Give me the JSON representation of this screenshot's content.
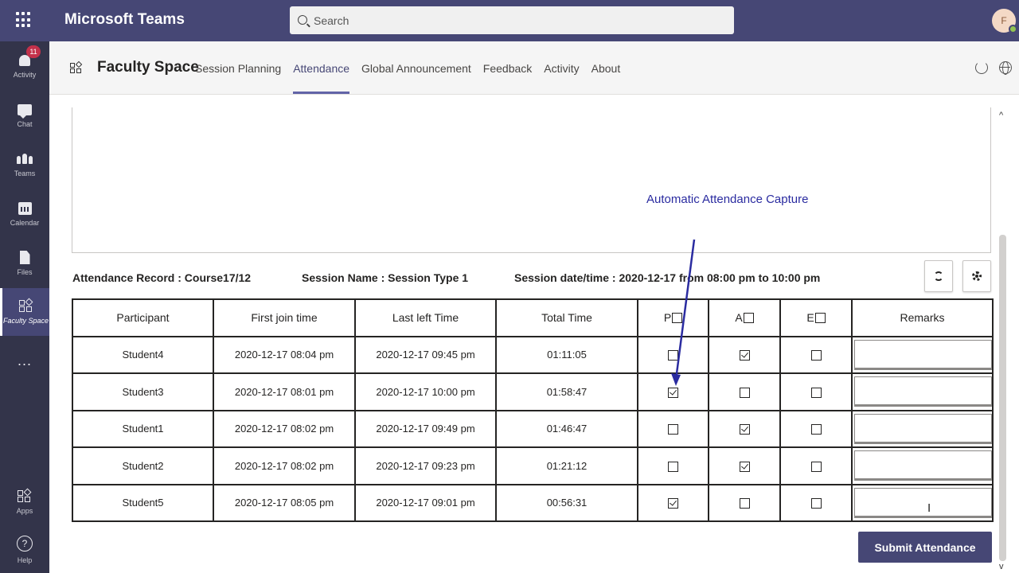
{
  "topbar": {
    "app_title": "Microsoft Teams",
    "search_placeholder": "Search",
    "avatar_initial": "F"
  },
  "rail": {
    "items": [
      {
        "label": "Activity",
        "badge": "11"
      },
      {
        "label": "Chat"
      },
      {
        "label": "Teams"
      },
      {
        "label": "Calendar"
      },
      {
        "label": "Files"
      },
      {
        "label": "Faculty Space"
      },
      {
        "label": "..."
      }
    ],
    "bottom": [
      {
        "label": "Apps"
      },
      {
        "label": "Help"
      }
    ]
  },
  "app_header": {
    "name": "Faculty Space",
    "tabs": [
      "Session Planning",
      "Attendance",
      "Global Announcement",
      "Feedback",
      "Activity",
      "About"
    ],
    "active_tab": "Attendance"
  },
  "annotation": "Automatic Attendance Capture",
  "record": {
    "attendance_record": "Attendance Record : Course17/12",
    "session_name": "Session Name : Session Type 1",
    "session_datetime": "Session date/time : 2020-12-17 from 08:00 pm to 10:00 pm"
  },
  "table": {
    "headers": {
      "participant": "Participant",
      "first_join": "First join time",
      "last_left": "Last left Time",
      "total_time": "Total Time",
      "p": "P",
      "a": "A",
      "e": "E",
      "remarks": "Remarks"
    },
    "rows": [
      {
        "participant": "Student4",
        "first_join": "2020-12-17 08:04 pm",
        "last_left": "2020-12-17 09:45 pm",
        "total_time": "01:11:05",
        "p": false,
        "a": true,
        "e": false,
        "remarks": ""
      },
      {
        "participant": "Student3",
        "first_join": "2020-12-17 08:01 pm",
        "last_left": "2020-12-17 10:00 pm",
        "total_time": "01:58:47",
        "p": true,
        "a": false,
        "e": false,
        "remarks": ""
      },
      {
        "participant": "Student1",
        "first_join": "2020-12-17 08:02 pm",
        "last_left": "2020-12-17 09:49 pm",
        "total_time": "01:46:47",
        "p": false,
        "a": true,
        "e": false,
        "remarks": ""
      },
      {
        "participant": "Student2",
        "first_join": "2020-12-17 08:02 pm",
        "last_left": "2020-12-17 09:23 pm",
        "total_time": "01:21:12",
        "p": false,
        "a": true,
        "e": false,
        "remarks": ""
      },
      {
        "participant": "Student5",
        "first_join": "2020-12-17 08:05 pm",
        "last_left": "2020-12-17 09:01 pm",
        "total_time": "00:56:31",
        "p": true,
        "a": false,
        "e": false,
        "remarks": ""
      }
    ]
  },
  "submit_label": "Submit Attendance",
  "colors": {
    "brand": "#464775",
    "rail": "#33344a",
    "accent": "#6264a7",
    "annotation": "#2a2ba0"
  }
}
